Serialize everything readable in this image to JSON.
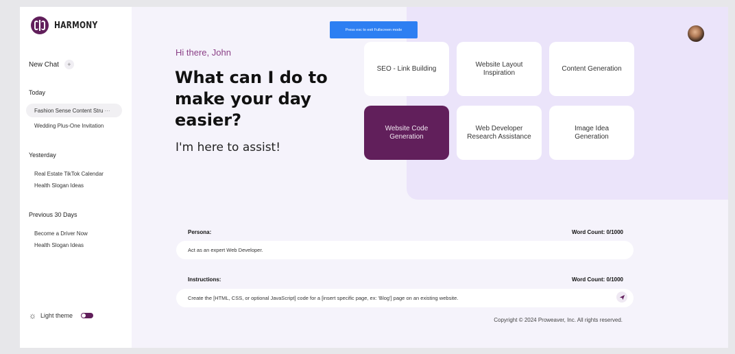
{
  "brand": {
    "name": "HARMONY"
  },
  "sidebar": {
    "new_chat_label": "New Chat",
    "new_chat_icon": "plus-icon",
    "sections": [
      {
        "label": "Today",
        "items": [
          "Fashion Sense Content Stru",
          "Wedding Plus-One Invitation"
        ]
      },
      {
        "label": "Yesterday",
        "items": [
          "Real Estate TikTok Calendar",
          "Health Slogan Ideas"
        ]
      },
      {
        "label": "Previous 30 Days",
        "items": [
          "Become a Driver Now",
          "Health Slogan Ideas"
        ]
      }
    ],
    "active_item_more": "···",
    "theme_label": "Light theme",
    "theme_icon": "sun-icon",
    "theme_toggle_on": true
  },
  "banner": {
    "text": "Press esc to exit Fullscreen mode"
  },
  "hero": {
    "greeting": "Hi there, John",
    "headline": "What can I do to make your day easier?",
    "subline": "I'm here to assist!"
  },
  "cards": [
    "SEO - Link Building",
    "Website Layout Inspiration",
    "Content Generation",
    "Website Code Generation",
    "Web Developer Research Assistance",
    "Image Idea Generation"
  ],
  "active_card_index": 3,
  "persona": {
    "label": "Persona:",
    "word_count": "Word Count: 0/1000",
    "value": "Act as an expert Web Developer."
  },
  "instructions": {
    "label": "Instructions:",
    "word_count": "Word Count: 0/1000",
    "value": "Create the [HTML, CSS, or optional JavaScript] code for a [insert specific page, ex: 'Blog'] page on an existing website."
  },
  "send_icon": "send-icon",
  "footer": {
    "copyright": "Copyright © 2024 Proweaver, Inc. All rights reserved."
  },
  "colors": {
    "accent": "#611f5b",
    "background": "#f5f3fb",
    "panel": "#ebe4fa",
    "banner": "#2d7ff2"
  }
}
